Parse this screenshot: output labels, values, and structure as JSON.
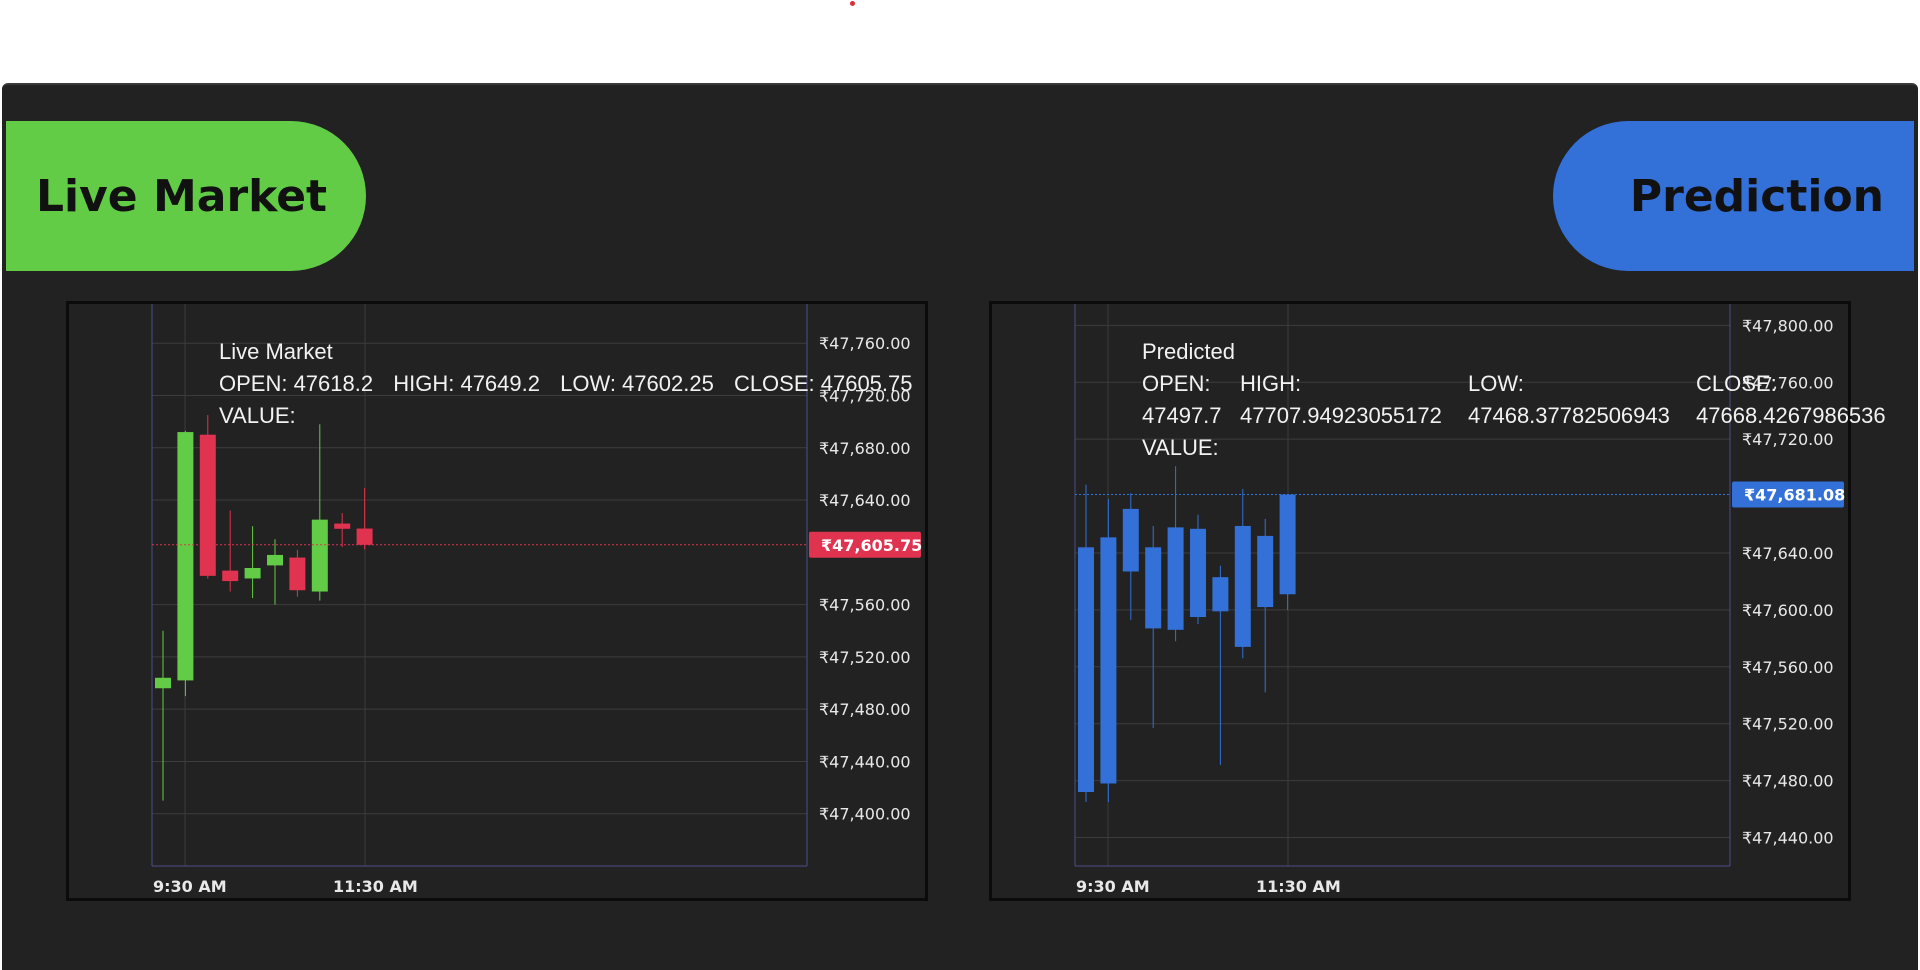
{
  "header_pills": {
    "live": "Live Market",
    "prediction": "Prediction"
  },
  "colors": {
    "live_pill": "#63cc46",
    "prediction_pill": "#3370d8",
    "up_candle": "#63cc46",
    "down_candle": "#e0334f",
    "predicted_candle": "#3370d8"
  },
  "chart_data": [
    {
      "type": "candlestick",
      "name": "Live Market",
      "legend": {
        "title": "Live Market",
        "open": "OPEN: 47618.2",
        "high": "HIGH: 47649.2",
        "low": "LOW: 47602.25",
        "close": "CLOSE: 47605.75",
        "value": "VALUE:"
      },
      "y_ticks": [
        "₹47,760.00",
        "₹47,720.00",
        "₹47,680.00",
        "₹47,640.00",
        "₹47,560.00",
        "₹47,520.00",
        "₹47,480.00",
        "₹47,440.00",
        "₹47,400.00"
      ],
      "y_tick_values": [
        47760,
        47720,
        47680,
        47640,
        47560,
        47520,
        47480,
        47440,
        47400
      ],
      "x_ticks": [
        "9:30 AM",
        "11:30 AM"
      ],
      "last_price_label": "₹47,605.75",
      "last_price": 47605.75,
      "ylim": [
        47360,
        47790
      ],
      "candles": [
        {
          "o": 47496,
          "h": 47540,
          "l": 47410,
          "c": 47504
        },
        {
          "o": 47502,
          "h": 47693,
          "l": 47490,
          "c": 47692
        },
        {
          "o": 47690,
          "h": 47705,
          "l": 47580,
          "c": 47582
        },
        {
          "o": 47586,
          "h": 47632,
          "l": 47570,
          "c": 47578
        },
        {
          "o": 47580,
          "h": 47620,
          "l": 47565,
          "c": 47588
        },
        {
          "o": 47590,
          "h": 47610,
          "l": 47560,
          "c": 47598
        },
        {
          "o": 47596,
          "h": 47602,
          "l": 47566,
          "c": 47571
        },
        {
          "o": 47570,
          "h": 47698,
          "l": 47563,
          "c": 47625
        },
        {
          "o": 47622,
          "h": 47630,
          "l": 47604,
          "c": 47618
        },
        {
          "o": 47618.2,
          "h": 47649.2,
          "l": 47602.25,
          "c": 47605.75
        }
      ],
      "grid": true
    },
    {
      "type": "candlestick",
      "name": "Predicted",
      "legend": {
        "title": "Predicted",
        "open_label": "OPEN:",
        "open": "47497.7",
        "high_label": "HIGH:",
        "high": "47707.94923055172",
        "low_label": "LOW:",
        "low": "47468.37782506943",
        "close_label": "CLOSE:",
        "close": "47668.4267986536",
        "value": "VALUE:"
      },
      "y_ticks": [
        "₹47,800.00",
        "₹47,760.00",
        "₹47,720.00",
        "₹47,640.00",
        "₹47,600.00",
        "₹47,560.00",
        "₹47,520.00",
        "₹47,480.00",
        "₹47,440.00"
      ],
      "y_tick_values": [
        47800,
        47760,
        47720,
        47640,
        47600,
        47560,
        47520,
        47480,
        47440
      ],
      "x_ticks": [
        "9:30 AM",
        "11:30 AM"
      ],
      "last_price_label": "₹47,681.08",
      "last_price": 47681.08,
      "ylim": [
        47420,
        47815
      ],
      "candles": [
        {
          "o": 47644,
          "h": 47688,
          "l": 47465,
          "c": 47472
        },
        {
          "o": 47478,
          "h": 47678,
          "l": 47465,
          "c": 47651
        },
        {
          "o": 47671,
          "h": 47682,
          "l": 47593,
          "c": 47627
        },
        {
          "o": 47644,
          "h": 47659,
          "l": 47517,
          "c": 47587
        },
        {
          "o": 47586,
          "h": 47701,
          "l": 47578,
          "c": 47658
        },
        {
          "o": 47657,
          "h": 47667,
          "l": 47590,
          "c": 47595
        },
        {
          "o": 47623,
          "h": 47631,
          "l": 47491,
          "c": 47599
        },
        {
          "o": 47574,
          "h": 47685,
          "l": 47566,
          "c": 47659
        },
        {
          "o": 47652,
          "h": 47664,
          "l": 47542,
          "c": 47602
        },
        {
          "o": 47611,
          "h": 47679,
          "l": 47600,
          "c": 47681.08
        }
      ],
      "grid": true
    }
  ]
}
